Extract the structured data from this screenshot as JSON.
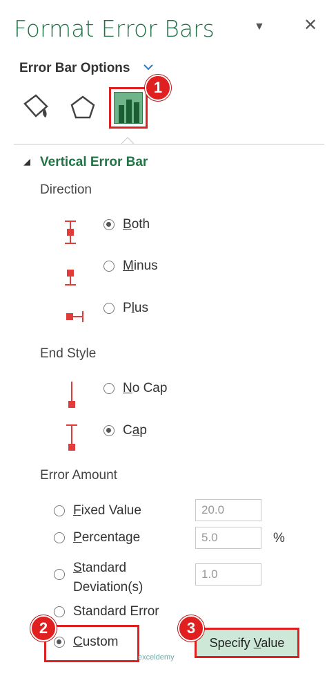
{
  "panel": {
    "title": "Format Error Bars",
    "options_title": "Error Bar Options"
  },
  "section": {
    "title": "Vertical Error Bar"
  },
  "direction": {
    "label": "Direction",
    "options": [
      {
        "label": "Both",
        "mnemonic": "B",
        "rest": "oth",
        "selected": true
      },
      {
        "label": "Minus",
        "mnemonic": "M",
        "rest": "inus",
        "selected": false
      },
      {
        "label": "Plus",
        "pre": "P",
        "mnemonic": "l",
        "rest": "us",
        "selected": false
      }
    ]
  },
  "end_style": {
    "label": "End Style",
    "options": [
      {
        "label": "No Cap",
        "mnemonic": "N",
        "rest": "o Cap",
        "selected": false
      },
      {
        "label": "Cap",
        "pre": "C",
        "mnemonic": "a",
        "rest": "p",
        "selected": true
      }
    ]
  },
  "error_amount": {
    "label": "Error Amount",
    "fixed_value": {
      "mnemonic": "F",
      "rest": "ixed Value",
      "value": "20.0"
    },
    "percentage": {
      "mnemonic": "P",
      "rest": "ercentage",
      "value": "5.0",
      "unit": "%"
    },
    "std_dev": {
      "line1_mnemonic": "S",
      "line1_rest": "tandard",
      "line2": "Deviation(s)",
      "value": "1.0"
    },
    "std_error": {
      "label": "Standard Error"
    },
    "custom": {
      "mnemonic": "C",
      "rest": "ustom",
      "selected": true
    },
    "specify_button": {
      "pre": "Specify ",
      "mnemonic": "V",
      "rest": "alue"
    }
  },
  "badges": [
    "1",
    "2",
    "3"
  ],
  "watermark": "exceldemy",
  "colors": {
    "accent_green": "#217346",
    "highlight_red": "#e02020",
    "icon_red": "#e03c3c"
  }
}
